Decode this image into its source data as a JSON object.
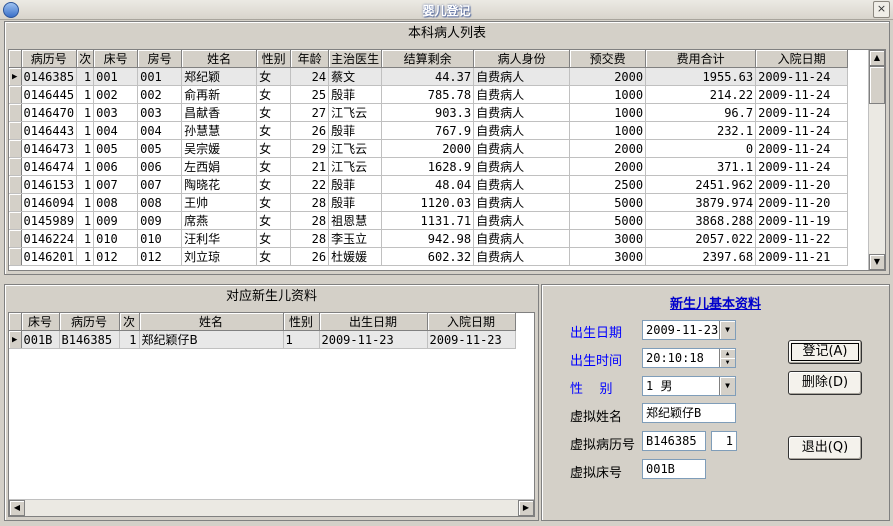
{
  "window": {
    "title": "婴儿登记",
    "close_glyph": "×"
  },
  "patients": {
    "title": "本科病人列表",
    "columns": [
      "病历号",
      "次",
      "床号",
      "房号",
      "姓名",
      "性别",
      "年龄",
      "主治医生",
      "结算剩余",
      "病人身份",
      "预交费",
      "费用合计",
      "入院日期"
    ],
    "rows": [
      [
        "0146385",
        "1",
        "001",
        "001",
        "郑纪颖",
        "女",
        "24",
        "蔡文",
        "44.37",
        "自费病人",
        "2000",
        "1955.63",
        "2009-11-24"
      ],
      [
        "0146445",
        "1",
        "002",
        "002",
        "俞再新",
        "女",
        "25",
        "殷菲",
        "785.78",
        "自费病人",
        "1000",
        "214.22",
        "2009-11-24"
      ],
      [
        "0146470",
        "1",
        "003",
        "003",
        "昌献香",
        "女",
        "27",
        "江飞云",
        "903.3",
        "自费病人",
        "1000",
        "96.7",
        "2009-11-24"
      ],
      [
        "0146443",
        "1",
        "004",
        "004",
        "孙慧慧",
        "女",
        "26",
        "殷菲",
        "767.9",
        "自费病人",
        "1000",
        "232.1",
        "2009-11-24"
      ],
      [
        "0146473",
        "1",
        "005",
        "005",
        "吴宗媛",
        "女",
        "29",
        "江飞云",
        "2000",
        "自费病人",
        "2000",
        "0",
        "2009-11-24"
      ],
      [
        "0146474",
        "1",
        "006",
        "006",
        "左西娟",
        "女",
        "21",
        "江飞云",
        "1628.9",
        "自费病人",
        "2000",
        "371.1",
        "2009-11-24"
      ],
      [
        "0146153",
        "1",
        "007",
        "007",
        "陶晓花",
        "女",
        "22",
        "殷菲",
        "48.04",
        "自费病人",
        "2500",
        "2451.962",
        "2009-11-20"
      ],
      [
        "0146094",
        "1",
        "008",
        "008",
        "王帅",
        "女",
        "28",
        "殷菲",
        "1120.03",
        "自费病人",
        "5000",
        "3879.974",
        "2009-11-20"
      ],
      [
        "0145989",
        "1",
        "009",
        "009",
        "席燕",
        "女",
        "28",
        "祖恩慧",
        "1131.71",
        "自费病人",
        "5000",
        "3868.288",
        "2009-11-19"
      ],
      [
        "0146224",
        "1",
        "010",
        "010",
        "汪利华",
        "女",
        "28",
        "李玉立",
        "942.98",
        "自费病人",
        "3000",
        "2057.022",
        "2009-11-22"
      ],
      [
        "0146201",
        "1",
        "012",
        "012",
        "刘立琼",
        "女",
        "26",
        "杜媛媛",
        "602.32",
        "自费病人",
        "3000",
        "2397.68",
        "2009-11-21"
      ]
    ]
  },
  "newborns": {
    "title": "对应新生儿资料",
    "columns": [
      "床号",
      "病历号",
      "次",
      "姓名",
      "性别",
      "出生日期",
      "入院日期"
    ],
    "rows": [
      [
        "001B",
        "B146385",
        "1",
        "郑纪颖仔B",
        "1",
        "2009-11-23",
        "2009-11-23"
      ]
    ]
  },
  "form": {
    "title": "新生儿基本资料",
    "birth_date_label": "出生日期",
    "birth_date_value": "2009-11-23",
    "birth_time_label": "出生时间",
    "birth_time_value": "20:10:18",
    "gender_label": "性    别",
    "gender_value": "1 男",
    "virtual_name_label": "虚拟姓名",
    "virtual_name_value": "郑纪颖仔B",
    "virtual_record_label": "虚拟病历号",
    "virtual_record_value": "B146385",
    "virtual_record_seq": "1",
    "virtual_bed_label": "虚拟床号",
    "virtual_bed_value": "001B"
  },
  "buttons": {
    "register": "登记(A)",
    "delete": "删除(D)",
    "exit": "退出(Q)"
  },
  "colors": {
    "form_title": "#0000cc",
    "label_blue": "#0000ff",
    "face": "#d4d0c8"
  }
}
